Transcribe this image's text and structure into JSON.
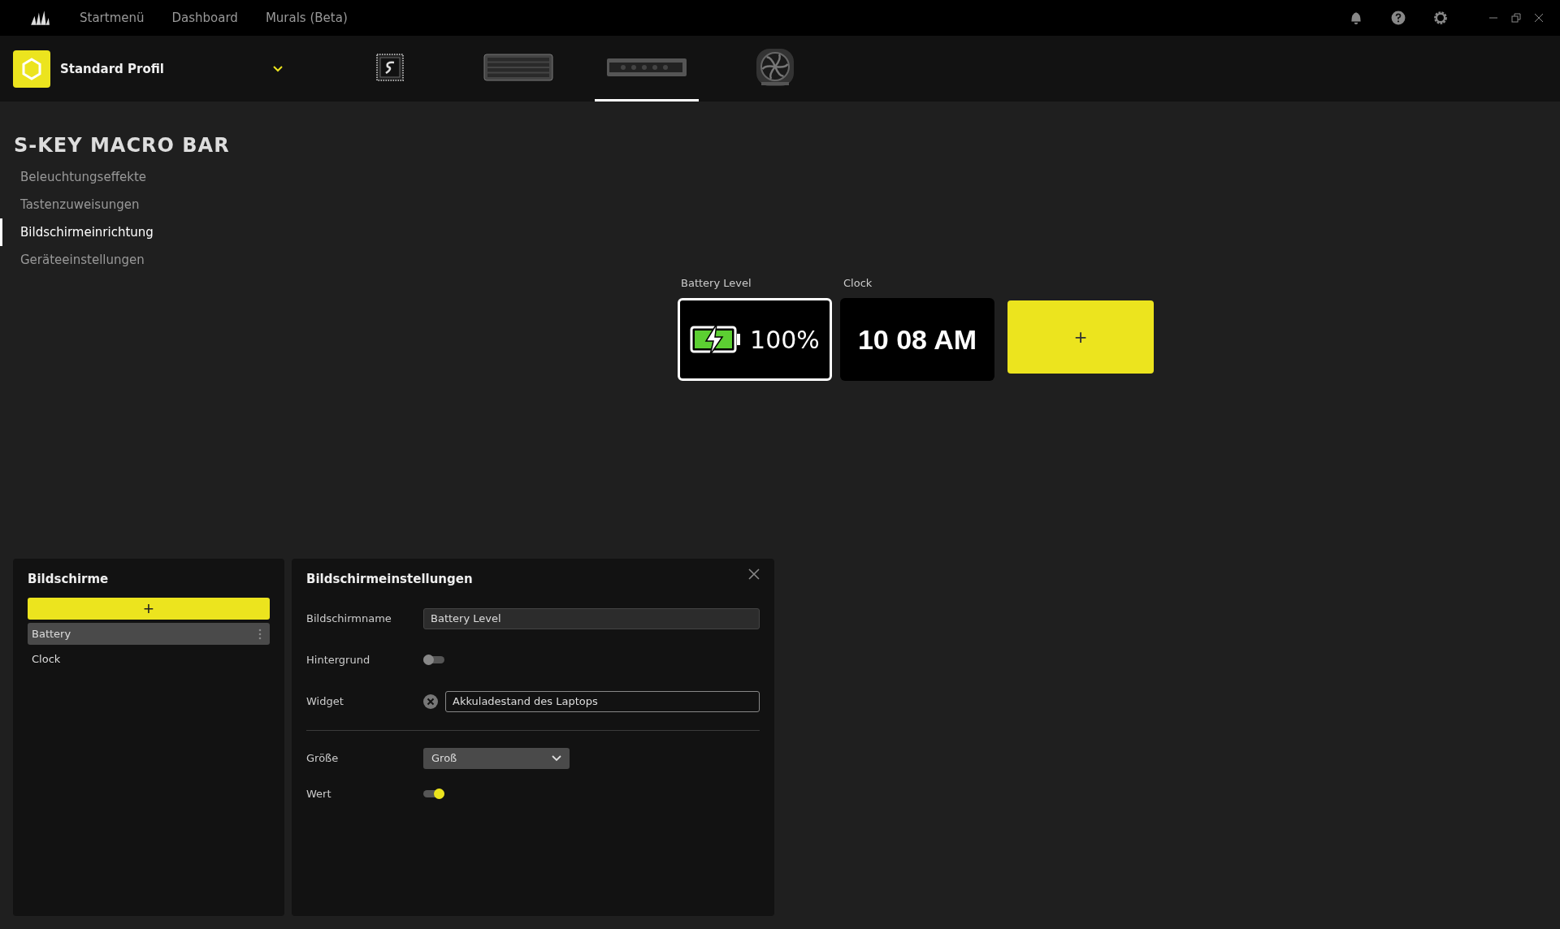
{
  "top_nav": [
    "Startmenü",
    "Dashboard",
    "Murals (Beta)"
  ],
  "profile": {
    "name": "Standard Profil"
  },
  "devices": [
    {
      "kind": "chip",
      "selected": false
    },
    {
      "kind": "keyboard",
      "selected": false
    },
    {
      "kind": "macrobar",
      "selected": true
    },
    {
      "kind": "fan",
      "selected": false
    }
  ],
  "page_title": "S-KEY MACRO BAR",
  "sidebar": {
    "items": [
      {
        "label": "Beleuchtungseffekte",
        "selected": false
      },
      {
        "label": "Tastenzuweisungen",
        "selected": false
      },
      {
        "label": "Bildschirmeinrichtung",
        "selected": true
      },
      {
        "label": "Geräteeinstellungen",
        "selected": false
      }
    ]
  },
  "screens_preview": [
    {
      "kind": "battery",
      "label": "Battery Level",
      "value": "100%",
      "selected": true
    },
    {
      "kind": "clock",
      "label": "Clock",
      "value": "10 08 AM",
      "selected": false
    },
    {
      "kind": "add",
      "value": "+"
    }
  ],
  "screens_panel": {
    "title": "Bildschirme",
    "add_label": "+",
    "items": [
      {
        "label": "Battery",
        "selected": true
      },
      {
        "label": "Clock",
        "selected": false
      }
    ]
  },
  "settings_panel": {
    "title": "Bildschirmeinstellungen",
    "screen_name": {
      "label": "Bildschirmname",
      "value": "Battery Level"
    },
    "background": {
      "label": "Hintergrund",
      "on": false
    },
    "widget": {
      "label": "Widget",
      "value": "Akkuladestand des Laptops"
    },
    "size": {
      "label": "Größe",
      "value": "Groß"
    },
    "value_toggle": {
      "label": "Wert",
      "on": true
    }
  }
}
